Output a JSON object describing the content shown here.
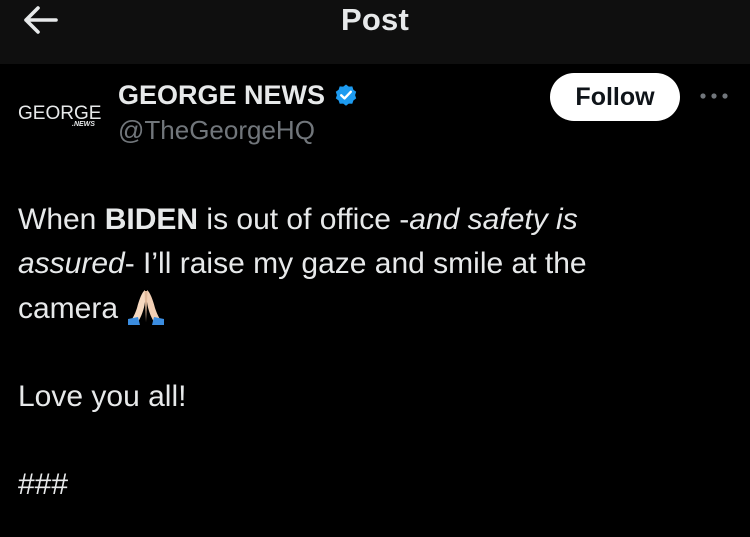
{
  "header": {
    "title": "Post",
    "back_icon": "arrow-left-icon"
  },
  "author": {
    "display_name": "GEORGE NEWS",
    "handle": "@TheGeorgeHQ",
    "avatar_text": "GEORGE",
    "avatar_subtext": ".NEWS",
    "verified_icon": "verified-badge-icon",
    "verified_color": "#1d9bf0"
  },
  "actions": {
    "follow_label": "Follow",
    "more_icon": "more-icon"
  },
  "post": {
    "line1_pre": "When ",
    "line1_bold": "BIDEN",
    "line1_mid": " is out of office -",
    "line1_italic": "and safety is",
    "line2_italic": "assured",
    "line2_rest": "- I’ll raise my gaze and smile at the",
    "line3": "camera",
    "emoji_icon": "folded-hands-icon",
    "para2": "Love you all!",
    "para3": "###"
  },
  "colors": {
    "background": "#000000",
    "header_background": "#0f0f0f",
    "text": "#e7e9ea",
    "secondary_text": "#71767b",
    "button_background": "#ffffff"
  }
}
